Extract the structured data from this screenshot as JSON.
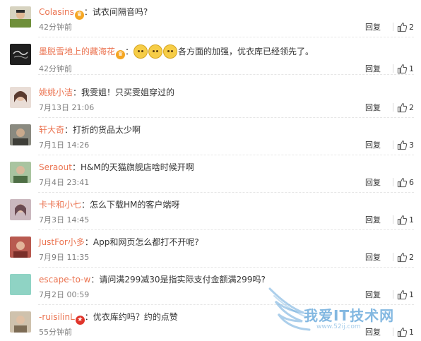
{
  "comments": [
    {
      "username": "Colasins",
      "badge": "crown",
      "text": "试衣间隔音吗?",
      "emoticons": 0,
      "time": "42分钟前",
      "reply": "回复",
      "likes": "2"
    },
    {
      "username": "墨脱雪地上的藏海花",
      "badge": "crown",
      "text": "各方面的加强，优衣库已经领先了。",
      "emoticons": 3,
      "time": "42分钟前",
      "reply": "回复",
      "likes": "1"
    },
    {
      "username": "姚姚小洁",
      "badge": "",
      "text": "我雯姐！只买雯姐穿过的",
      "emoticons": 0,
      "time": "7月13日 21:06",
      "reply": "回复",
      "likes": "2"
    },
    {
      "username": "轩大奇",
      "badge": "",
      "text": "打折的货品太少啊",
      "emoticons": 0,
      "time": "7月1日 14:26",
      "reply": "回复",
      "likes": "3"
    },
    {
      "username": "Seraout",
      "badge": "",
      "text": "H&M的天猫旗舰店啥时候开啊",
      "emoticons": 0,
      "time": "7月4日 23:41",
      "reply": "回复",
      "likes": "6"
    },
    {
      "username": "卡卡和小七",
      "badge": "",
      "text": "怎么下载HM的客户端呀",
      "emoticons": 0,
      "time": "7月3日 14:45",
      "reply": "回复",
      "likes": "1"
    },
    {
      "username": "JustFor小多",
      "badge": "",
      "text": "App和网页怎么都打不开呢?",
      "emoticons": 0,
      "time": "7月9日 11:35",
      "reply": "回复",
      "likes": "2"
    },
    {
      "username": "escape-to-w",
      "badge": "",
      "text": "请问满299减30是指实际支付金额满299吗?",
      "emoticons": 0,
      "time": "7月2日 00:59",
      "reply": "回复",
      "likes": "1"
    },
    {
      "username": "-ruisilinL",
      "badge": "star",
      "text": "优衣库约吗？约的点赞",
      "emoticons": 0,
      "time": "55分钟前",
      "reply": "回复",
      "likes": "1"
    }
  ],
  "avatar_colors": [
    "#6f8f3a",
    "#2a2a2a",
    "#c9a89a",
    "#5a5a4e",
    "#7a9e6e",
    "#8a6b73",
    "#a0463f",
    "#8fd3c4",
    "#9a8870"
  ],
  "watermark": {
    "text": "我爱IT技术网",
    "url": "www.52ij.com"
  },
  "colors": {
    "username": "#eb7350",
    "meta": "#808080",
    "text": "#333333"
  }
}
